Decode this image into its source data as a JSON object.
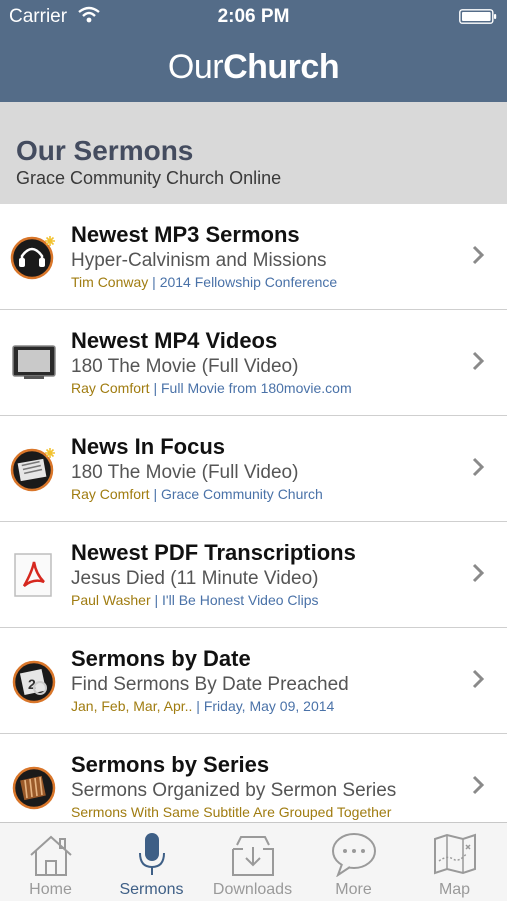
{
  "status_bar": {
    "carrier": "Carrier",
    "time": "2:06 PM"
  },
  "nav": {
    "brand_light": "Our",
    "brand_bold": "Church"
  },
  "header": {
    "title": "Our Sermons",
    "subtitle": "Grace Community Church Online"
  },
  "colors": {
    "nav_bg": "#546c88",
    "author": "#a07c10",
    "source": "#4a72a8",
    "active_tab": "#3e5f86"
  },
  "items": [
    {
      "icon": "headphones-icon",
      "title": "Newest MP3 Sermons",
      "subtitle": "Hyper-Calvinism and Missions",
      "author": "Tim Conway",
      "sep": " | ",
      "source": "2014 Fellowship Conference"
    },
    {
      "icon": "tv-icon",
      "title": "Newest MP4 Videos",
      "subtitle": "180 The Movie (Full Video)",
      "author": "Ray Comfort",
      "sep": " | ",
      "source": "Full Movie from 180movie.com"
    },
    {
      "icon": "newspaper-icon",
      "title": "News In Focus",
      "subtitle": "180 The Movie (Full Video)",
      "author": "Ray Comfort",
      "sep": " | ",
      "source": "Grace Community Church"
    },
    {
      "icon": "pdf-icon",
      "title": "Newest PDF Transcriptions",
      "subtitle": "Jesus Died (11 Minute Video)",
      "author": "Paul Washer",
      "sep": " | ",
      "source": "I'll Be Honest Video Clips"
    },
    {
      "icon": "calendar-icon",
      "title": "Sermons by Date",
      "subtitle": "Find Sermons By Date Preached",
      "author": "Jan, Feb, Mar, Apr..",
      "sep": " | ",
      "source": "Friday, May 09, 2014"
    },
    {
      "icon": "books-icon",
      "title": "Sermons by Series",
      "subtitle": "Sermons Organized by Sermon Series",
      "author": "Sermons With Same Subtitle Are Grouped Together",
      "sep": "",
      "source": ""
    }
  ],
  "tabs": [
    {
      "label": "Home",
      "icon": "house-icon"
    },
    {
      "label": "Sermons",
      "icon": "microphone-icon"
    },
    {
      "label": "Downloads",
      "icon": "download-icon"
    },
    {
      "label": "More",
      "icon": "speech-bubble-icon"
    },
    {
      "label": "Map",
      "icon": "map-icon"
    }
  ]
}
